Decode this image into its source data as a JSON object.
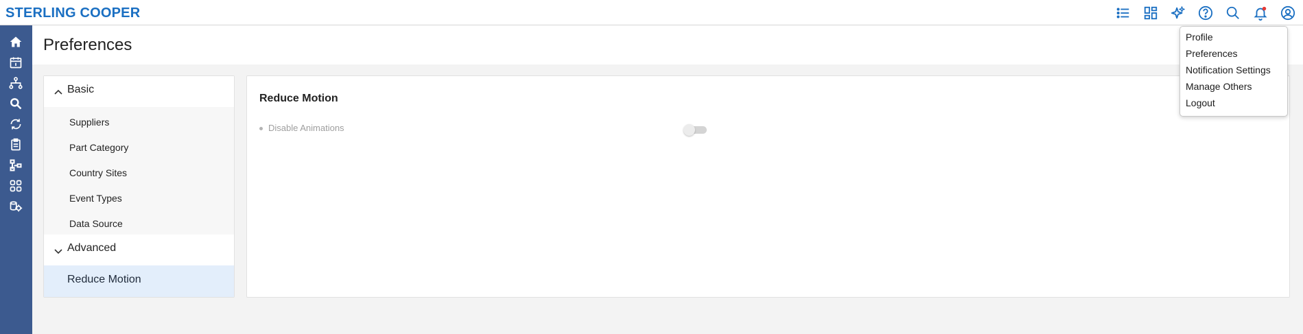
{
  "app": {
    "brand": "STERLING COOPER"
  },
  "header_icons": [
    {
      "name": "list-icon"
    },
    {
      "name": "dashboard-icon"
    },
    {
      "name": "sparkle-icon"
    },
    {
      "name": "help-icon"
    },
    {
      "name": "search-icon"
    },
    {
      "name": "notification-bell-icon"
    },
    {
      "name": "user-account-icon"
    }
  ],
  "sidebar_icons": [
    "home-icon",
    "calendar-icon",
    "hierarchy-icon",
    "search-analytics-icon",
    "refresh-cycle-icon",
    "clipboard-icon",
    "workflow-icon",
    "apps-grid-icon",
    "settings-data-icon"
  ],
  "page": {
    "title": "Preferences"
  },
  "left_nav": {
    "basic": {
      "label": "Basic",
      "items": [
        "Suppliers",
        "Part Category",
        "Country Sites",
        "Event Types",
        "Data Source"
      ]
    },
    "advanced": {
      "label": "Advanced",
      "items": [
        "Reduce Motion"
      ]
    }
  },
  "content": {
    "section_title": "Reduce Motion",
    "settings": [
      {
        "label": "Disable Animations",
        "enabled": false
      }
    ]
  },
  "user_menu": {
    "items": [
      "Profile",
      "Preferences",
      "Notification Settings",
      "Manage Others",
      "Logout"
    ]
  },
  "colors": {
    "brand": "#1a6fc2",
    "sidebar": "#3c5a8f",
    "active_item_bg": "#e3eefb",
    "notification_dot": "#e53935"
  }
}
